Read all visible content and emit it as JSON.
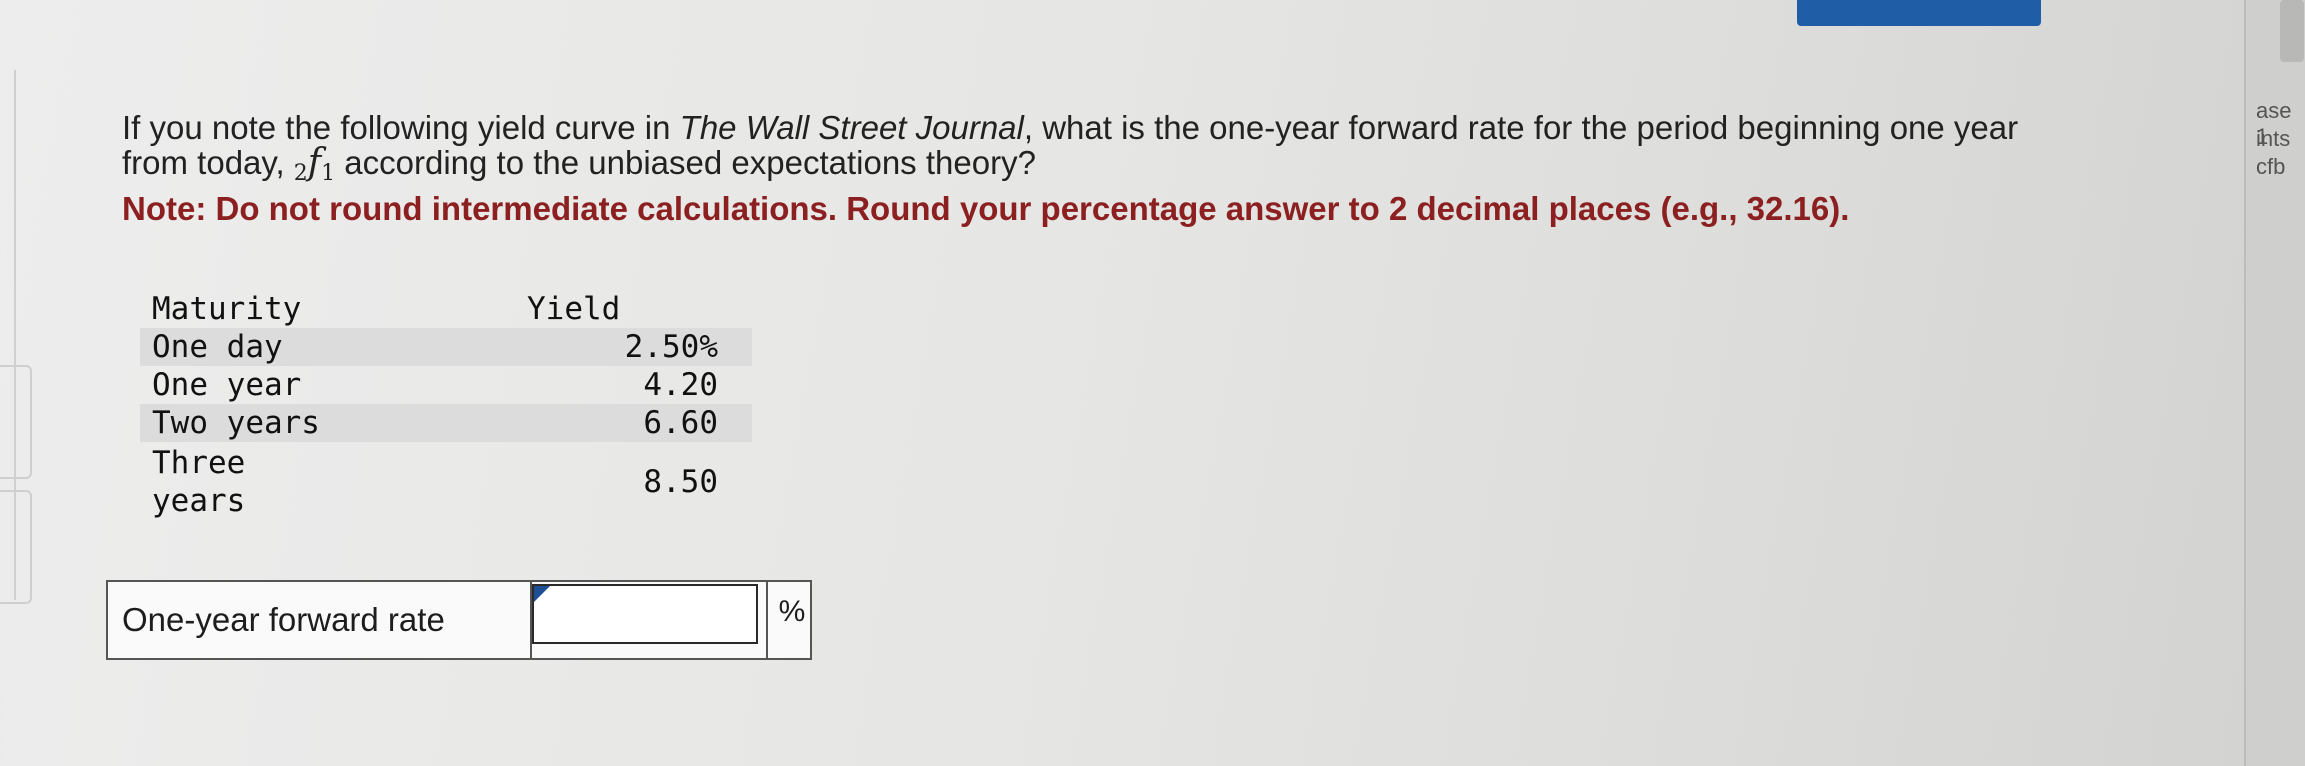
{
  "question": {
    "intro": "If you note the following yield curve in ",
    "journal": "The Wall Street Journal",
    "rest": ", what is the one-year forward rate for the period beginning one year from today, ",
    "forward_symbol": "f",
    "forward_pre": "2",
    "forward_sub": "1",
    "tail": " according to the unbiased expectations theory?",
    "note": "Note: Do not round intermediate calculations. Round your percentage answer to 2 decimal places (e.g., 32.16)."
  },
  "yield_table": {
    "headers": [
      "Maturity",
      "Yield"
    ],
    "rows": [
      {
        "maturity": "One day",
        "yield": "2.50%"
      },
      {
        "maturity": "One year",
        "yield": "4.20"
      },
      {
        "maturity": "Two years",
        "yield": "6.60"
      },
      {
        "maturity": "Three years",
        "yield": "8.50"
      }
    ]
  },
  "answer": {
    "label": "One-year forward rate",
    "value": "",
    "unit": "%"
  },
  "right_panel": {
    "line1": "ase 1",
    "line2": "ints",
    "line3": "cfb"
  },
  "colors": {
    "note": "#8c1f20",
    "button": "#1f5ea7",
    "flag": "#1c4f93"
  }
}
